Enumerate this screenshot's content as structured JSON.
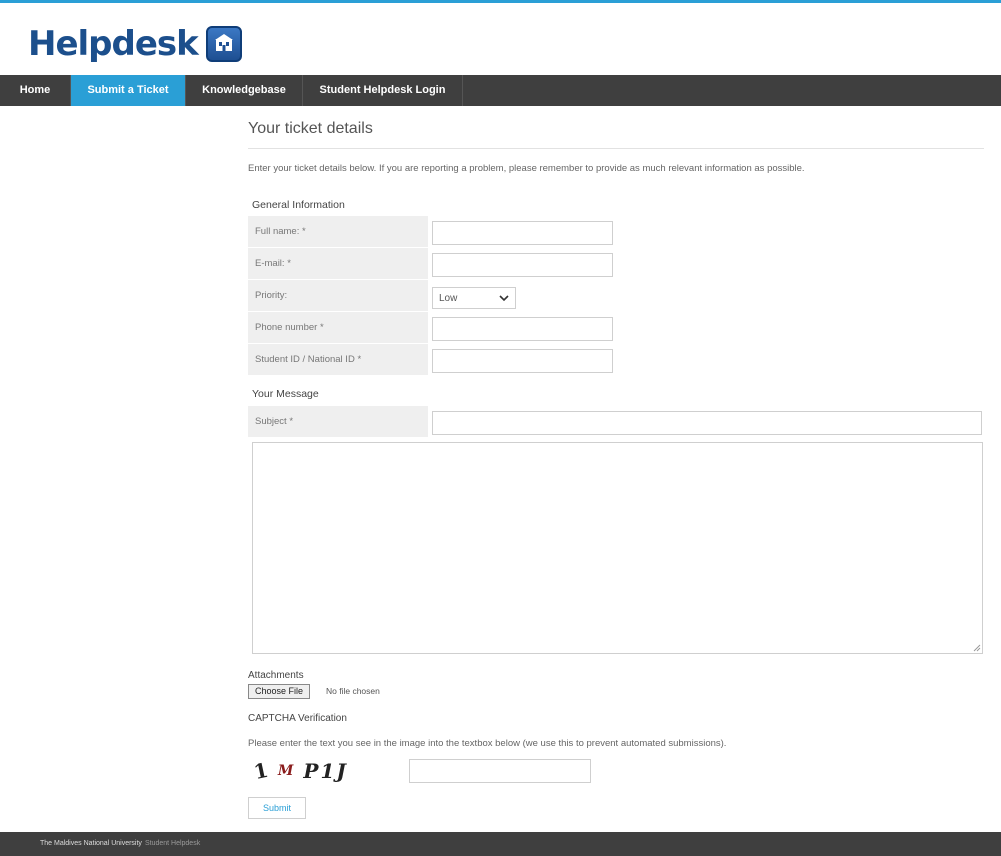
{
  "logo": {
    "text": "Helpdesk",
    "icon": "building-icon"
  },
  "nav": {
    "items": [
      {
        "label": "Home",
        "active": false
      },
      {
        "label": "Submit a Ticket",
        "active": true
      },
      {
        "label": "Knowledgebase",
        "active": false
      },
      {
        "label": "Student Helpdesk Login",
        "active": false
      }
    ]
  },
  "page": {
    "title": "Your ticket details",
    "intro": "Enter your ticket details below. If you are reporting a problem, please remember to provide as much relevant information as possible."
  },
  "general": {
    "heading": "General Information",
    "full_name_label": "Full name: *",
    "email_label": "E-mail: *",
    "priority_label": "Priority:",
    "priority_value": "Low",
    "phone_label": "Phone number *",
    "student_id_label": "Student ID / National ID *"
  },
  "message": {
    "heading": "Your Message",
    "subject_label": "Subject *"
  },
  "attachments": {
    "heading": "Attachments",
    "button_label": "Choose File",
    "status": "No file chosen"
  },
  "captcha": {
    "heading": "CAPTCHA Verification",
    "instructions": "Please enter the text you see in the image into the textbox below (we use this to prevent automated submissions).",
    "chars": [
      "1",
      "M",
      "P1J"
    ]
  },
  "submit_label": "Submit",
  "footer": {
    "org": "The Maldives National University",
    "sub": "Student Helpdesk"
  },
  "colors": {
    "accent": "#2a9fd6",
    "nav_bg": "#3f3f3f",
    "label_bg": "#efefef"
  }
}
